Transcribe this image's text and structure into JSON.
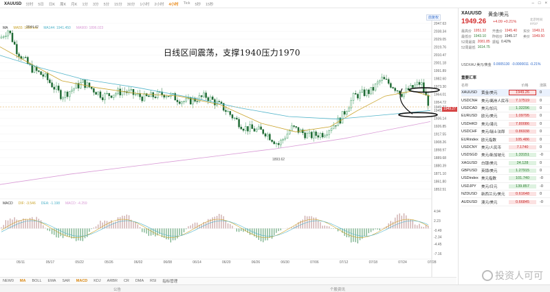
{
  "toolbar": {
    "symbol": "XAUUSD",
    "periods": [
      {
        "label": "分时",
        "active": false
      },
      {
        "label": "5日",
        "active": false
      },
      {
        "label": "日K",
        "active": false
      },
      {
        "label": "周K",
        "active": false
      },
      {
        "label": "月K",
        "active": false
      },
      {
        "label": "1分",
        "active": false
      },
      {
        "label": "3分",
        "active": false
      },
      {
        "label": "5分",
        "active": false
      },
      {
        "label": "15分",
        "active": false
      },
      {
        "label": "30分",
        "active": false
      },
      {
        "label": "1小时",
        "active": false
      },
      {
        "label": "2小时",
        "active": false
      },
      {
        "label": "4小时",
        "active": true
      },
      {
        "label": "Tick",
        "active": false
      },
      {
        "label": "5秒",
        "active": false
      },
      {
        "label": "15秒",
        "active": false
      }
    ]
  },
  "chart": {
    "annotation": "日线区间震荡，支撑1940压力1970",
    "indicator_prefix": "MA",
    "ma1_label": "MA55: 1958.xxx",
    "ma2_label": "MA144: 1941.450",
    "ma3_label": "MA900: 1896.023",
    "high_label": "2044.42",
    "low_label": "1893.62",
    "zoom_label": "前复权",
    "year_label": "2023",
    "price_axis": [
      "2047.63",
      "2038.34",
      "2029.05",
      "2019.76",
      "2010.47",
      "2001.18",
      "1991.89",
      "1982.60",
      "1973.30",
      "1964.01",
      "1954.72",
      "1949.27",
      "1945.43",
      "1936.14",
      "1926.85",
      "1917.55",
      "1908.26",
      "1898.97",
      "1889.68",
      "1880.39",
      "1871.10",
      "1861.80",
      "1852.51"
    ],
    "macd_axis": [
      "4.94",
      "2.23",
      "-0.49",
      "-2.34",
      "-4.45",
      "-7.16"
    ],
    "date_axis": [
      "05/11",
      "05/17",
      "05/22",
      "05/26",
      "06/02",
      "06/08",
      "06/14",
      "06/20",
      "06/26",
      "06/30",
      "07/06",
      "07/12",
      "07/18",
      "07/24",
      "07/28"
    ],
    "last_price_tag": "1949.27",
    "macd_legend": {
      "name": "MACD",
      "dif": "DIF: -3.546",
      "dea": "DEA: -1.198",
      "macd": "MACD: -4.259"
    },
    "colors": {
      "up": "#2e8b57",
      "down": "#2b7a3a",
      "ma1": "#c9a227",
      "ma2": "#4fb3c9",
      "ma3": "#d99ad6",
      "price": "#d64545"
    }
  },
  "indicators": [
    "NEW0",
    "MA",
    "BOLL",
    "EMA",
    "SAR",
    "MACD",
    "KDJ",
    "ARBR",
    "CR",
    "DMA",
    "RSI",
    "指标管理"
  ],
  "active_indicators": [
    "MA",
    "MACD"
  ],
  "bottom": {
    "left": "公告",
    "right": "个股资讯"
  },
  "watermark": "投资人可可",
  "quote": {
    "symbol": "XAUUSD",
    "name": "黄金/美元",
    "price": "1949.26",
    "change": "+4.09 +0.21%",
    "time": "北京时间 07/27",
    "stats": [
      [
        {
          "k": "最高价",
          "v": "1951.32",
          "c": "up"
        },
        {
          "k": "开盘价",
          "v": "1945.40",
          "c": "up"
        },
        {
          "k": "买价",
          "v": "1949.21",
          "c": "up"
        }
      ],
      [
        {
          "k": "最低价",
          "v": "1943.10",
          "c": "down"
        },
        {
          "k": "昨收价",
          "v": "1945.17",
          "c": "neu"
        },
        {
          "k": "卖价",
          "v": "1949.50",
          "c": "up"
        }
      ],
      [
        {
          "k": "52周最高",
          "v": "2081.85",
          "c": "up"
        },
        {
          "k": "振幅",
          "v": "0.42%",
          "c": "neu"
        },
        {
          "k": "",
          "v": "",
          "c": "neu"
        }
      ],
      [
        {
          "k": "52周最低",
          "v": "1614.75",
          "c": "down"
        },
        {
          "k": "",
          "v": "",
          "c": "neu"
        },
        {
          "k": "",
          "v": "",
          "c": "neu"
        }
      ]
    ],
    "cross_label": "USDXAU 美元/黄金",
    "cross_value": "0.0005130",
    "cross_change": "-0.0000011 -0.21%"
  },
  "watchlist": {
    "title": "重要汇率",
    "headers": [
      "名称",
      "",
      "价格",
      "涨跌"
    ],
    "rows": [
      {
        "sym": "XAUUSD",
        "name": "黄金/美元",
        "price": "1949.26",
        "dir": "up",
        "chg": "0",
        "selected": true
      },
      {
        "sym": "USDCNH",
        "name": "美元/离岸人民币",
        "price": "7.17519",
        "dir": "up",
        "chg": "0",
        "selected": false
      },
      {
        "sym": "USDCAD",
        "name": "美元/加元",
        "price": "1.32296",
        "dir": "down",
        "chg": "0",
        "selected": false
      },
      {
        "sym": "EURUSD",
        "name": "欧元/美元",
        "price": "1.09795",
        "dir": "up",
        "chg": "0",
        "selected": false
      },
      {
        "sym": "USDHKD",
        "name": "美元/港元",
        "price": "7.80086",
        "dir": "up",
        "chg": "0",
        "selected": false
      },
      {
        "sym": "USDCHF",
        "name": "美元/瑞士法郎",
        "price": "0.86938",
        "dir": "up",
        "chg": "0",
        "selected": false
      },
      {
        "sym": "EURindex",
        "name": "欧元指数",
        "price": "105.486",
        "dir": "up",
        "chg": "0",
        "selected": false
      },
      {
        "sym": "USDCNY",
        "name": "美元/人民币",
        "price": "7.1740",
        "dir": "up",
        "chg": "0",
        "selected": false
      },
      {
        "sym": "USDSGD",
        "name": "美元/新加坡元",
        "price": "1.33151",
        "dir": "down",
        "chg": "-0",
        "selected": false
      },
      {
        "sym": "XAGUSD",
        "name": "白银/美元",
        "price": "24.128",
        "dir": "down",
        "chg": "0",
        "selected": false
      },
      {
        "sym": "GBPUSD",
        "name": "英镑/美元",
        "price": "1.27915",
        "dir": "down",
        "chg": "0",
        "selected": false
      },
      {
        "sym": "USDindex",
        "name": "美元指数",
        "price": "101.740",
        "dir": "down",
        "chg": "-0",
        "selected": false
      },
      {
        "sym": "USDJPY",
        "name": "美元/日元",
        "price": "139.857",
        "dir": "down",
        "chg": "-0",
        "selected": false
      },
      {
        "sym": "NZDUSD",
        "name": "新西兰元/美元",
        "price": "0.61648",
        "dir": "up",
        "chg": "0",
        "selected": false
      },
      {
        "sym": "AUDUSD",
        "name": "澳元/美元",
        "price": "0.66845",
        "dir": "up",
        "chg": "-0",
        "selected": false
      }
    ]
  }
}
